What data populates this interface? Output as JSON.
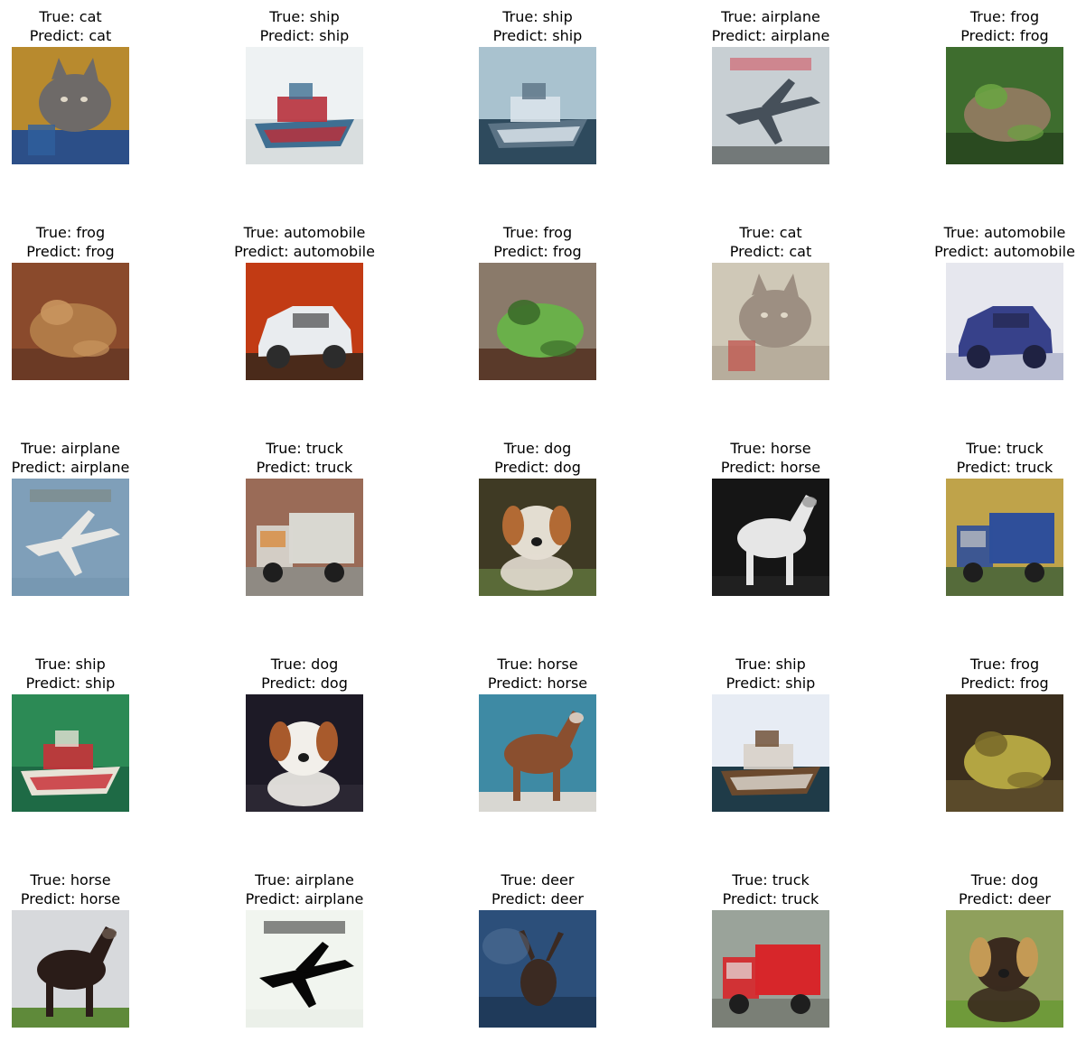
{
  "labels": {
    "true_prefix": "True: ",
    "predict_prefix": "Predict: "
  },
  "samples": [
    {
      "true": "cat",
      "predict": "cat",
      "subject": "cat-photo",
      "bg": "#b88a2e",
      "main": "#6e6a68",
      "accent": "#2f5f9e",
      "ground": "#2c4f88"
    },
    {
      "true": "ship",
      "predict": "ship",
      "subject": "ship-photo",
      "bg": "#eef2f3",
      "main": "#3f6f92",
      "accent": "#b7313c",
      "ground": "#d9dedf"
    },
    {
      "true": "ship",
      "predict": "ship",
      "subject": "ship-photo",
      "bg": "#a9c2cf",
      "main": "#5b7385",
      "accent": "#d9e3ea",
      "ground": "#2e4a5d"
    },
    {
      "true": "airplane",
      "predict": "airplane",
      "subject": "airplane-photo",
      "bg": "#c8cfd3",
      "main": "#46505a",
      "accent": "#d34a58",
      "ground": "#3b3f3e"
    },
    {
      "true": "frog",
      "predict": "frog",
      "subject": "frog-photo",
      "bg": "#3e6d2e",
      "main": "#8c7a5d",
      "accent": "#6aa342",
      "ground": "#2a4a20"
    },
    {
      "true": "frog",
      "predict": "frog",
      "subject": "frog-photo",
      "bg": "#8a4a2c",
      "main": "#b07a47",
      "accent": "#c9955e",
      "ground": "#6b3a25"
    },
    {
      "true": "automobile",
      "predict": "automobile",
      "subject": "car-photo",
      "bg": "#c23b14",
      "main": "#e9ecef",
      "accent": "#2c2c2c",
      "ground": "#4a2a1a"
    },
    {
      "true": "frog",
      "predict": "frog",
      "subject": "frog-photo",
      "bg": "#8a7a6a",
      "main": "#6ab04a",
      "accent": "#3c6d2a",
      "ground": "#5a3a2a"
    },
    {
      "true": "cat",
      "predict": "cat",
      "subject": "cat-photo",
      "bg": "#cfc8b7",
      "main": "#9d8f82",
      "accent": "#c05a52",
      "ground": "#b7ad9c"
    },
    {
      "true": "automobile",
      "predict": "automobile",
      "subject": "car-photo",
      "bg": "#e6e7ee",
      "main": "#37418a",
      "accent": "#1f2242",
      "ground": "#b9bdd2"
    },
    {
      "true": "airplane",
      "predict": "airplane",
      "subject": "airplane-photo",
      "bg": "#7f9fb9",
      "main": "#e7e7e4",
      "accent": "#7d8478",
      "ground": "#7294ae"
    },
    {
      "true": "truck",
      "predict": "truck",
      "subject": "truck-photo",
      "bg": "#9a6b57",
      "main": "#d9d8d1",
      "accent": "#d9822b",
      "ground": "#8f8a83"
    },
    {
      "true": "dog",
      "predict": "dog",
      "subject": "dog-photo",
      "bg": "#3f3a24",
      "main": "#e3ddd1",
      "accent": "#b26a34",
      "ground": "#5a6a38"
    },
    {
      "true": "horse",
      "predict": "horse",
      "subject": "horse-photo",
      "bg": "#151515",
      "main": "#e6e6e6",
      "accent": "#9a9a9a",
      "ground": "#202020"
    },
    {
      "true": "truck",
      "predict": "truck",
      "subject": "truck-photo",
      "bg": "#bfa34a",
      "main": "#2f4f9a",
      "accent": "#c9c9c9",
      "ground": "#556b3a"
    },
    {
      "true": "ship",
      "predict": "ship",
      "subject": "ship-photo",
      "bg": "#2c8a55",
      "main": "#e7e2d6",
      "accent": "#c8323a",
      "ground": "#1e6a45"
    },
    {
      "true": "dog",
      "predict": "dog",
      "subject": "dog-photo",
      "bg": "#1d1a26",
      "main": "#f2efea",
      "accent": "#a85a2c",
      "ground": "#2b2733"
    },
    {
      "true": "horse",
      "predict": "horse",
      "subject": "horse-photo",
      "bg": "#3e8aa4",
      "main": "#8a4f2f",
      "accent": "#e7e3dc",
      "ground": "#d8d7d2"
    },
    {
      "true": "ship",
      "predict": "ship",
      "subject": "ship-photo",
      "bg": "#e7ecf4",
      "main": "#6b4a2e",
      "accent": "#d8d2c9",
      "ground": "#1f3b48"
    },
    {
      "true": "frog",
      "predict": "frog",
      "subject": "frog-photo",
      "bg": "#3b2e1d",
      "main": "#b3a542",
      "accent": "#7a6b2a",
      "ground": "#5a4a2a"
    },
    {
      "true": "horse",
      "predict": "horse",
      "subject": "horse-photo",
      "bg": "#d7d9dc",
      "main": "#2a1c18",
      "accent": "#6b5a4f",
      "ground": "#5f8a3a"
    },
    {
      "true": "airplane",
      "predict": "airplane",
      "subject": "airplane-photo",
      "bg": "#f1f5ef",
      "main": "#070707",
      "accent": "#2a2a2a",
      "ground": "#e8ede5"
    },
    {
      "true": "deer",
      "predict": "deer",
      "subject": "deer-photo",
      "bg": "#2c4f7a",
      "main": "#3b2a22",
      "accent": "#6b88a8",
      "ground": "#1f3a5a"
    },
    {
      "true": "truck",
      "predict": "truck",
      "subject": "truck-photo",
      "bg": "#9aa39a",
      "main": "#d7262a",
      "accent": "#e6e6e6",
      "ground": "#7a7f76"
    },
    {
      "true": "dog",
      "predict": "deer",
      "subject": "dog-photo",
      "bg": "#8fa05c",
      "main": "#3a2a1e",
      "accent": "#c49a55",
      "ground": "#6f9a3a"
    }
  ]
}
